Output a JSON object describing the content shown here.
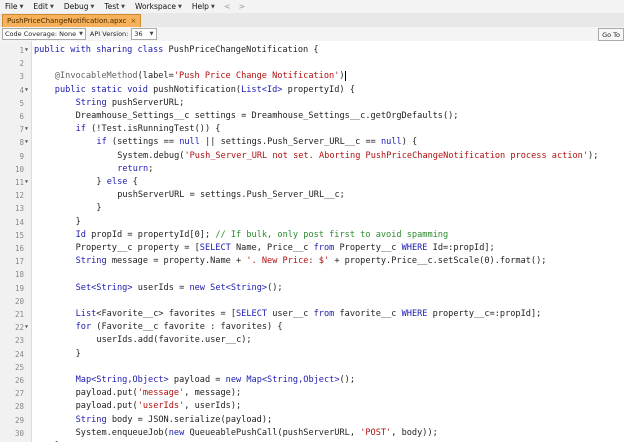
{
  "menu": {
    "items": [
      {
        "label": "File"
      },
      {
        "label": "Edit"
      },
      {
        "label": "Debug"
      },
      {
        "label": "Test"
      },
      {
        "label": "Workspace"
      },
      {
        "label": "Help"
      }
    ],
    "back": "<",
    "forward": ">"
  },
  "tab": {
    "title": "PushPriceChangeNotification.apxc",
    "close": "×"
  },
  "toolbar": {
    "coverage_label": "Code Coverage: None",
    "api_label": "API Version:",
    "api_value": "36",
    "goto_label": "Go To"
  },
  "editor": {
    "lines": [
      {
        "n": "1",
        "fold": true,
        "indent": 0,
        "tokens": [
          {
            "t": "kw",
            "v": "public with sharing class "
          },
          {
            "t": "pl",
            "v": "PushPriceChangeNotification {"
          }
        ]
      },
      {
        "n": "2",
        "fold": false,
        "indent": 0,
        "tokens": []
      },
      {
        "n": "3",
        "fold": false,
        "indent": 4,
        "tokens": [
          {
            "t": "an",
            "v": "@InvocableMethod"
          },
          {
            "t": "pl",
            "v": "(label="
          },
          {
            "t": "st",
            "v": "'Push Price Change Notification'"
          },
          {
            "t": "pl",
            "v": ")"
          },
          {
            "t": "cur",
            "v": ""
          }
        ]
      },
      {
        "n": "4",
        "fold": true,
        "indent": 4,
        "tokens": [
          {
            "t": "kw",
            "v": "public static void "
          },
          {
            "t": "pl",
            "v": "pushNotification("
          },
          {
            "t": "ty",
            "v": "List<Id>"
          },
          {
            "t": "pl",
            "v": " propertyId) {"
          }
        ]
      },
      {
        "n": "5",
        "fold": false,
        "indent": 8,
        "tokens": [
          {
            "t": "ty",
            "v": "String"
          },
          {
            "t": "pl",
            "v": " pushServerURL;"
          }
        ]
      },
      {
        "n": "6",
        "fold": false,
        "indent": 8,
        "tokens": [
          {
            "t": "pl",
            "v": "Dreamhouse_Settings__c settings = Dreamhouse_Settings__c.getOrgDefaults();"
          }
        ]
      },
      {
        "n": "7",
        "fold": true,
        "indent": 8,
        "tokens": [
          {
            "t": "kw",
            "v": "if"
          },
          {
            "t": "pl",
            "v": " (!Test.isRunningTest()) {"
          }
        ]
      },
      {
        "n": "8",
        "fold": true,
        "indent": 12,
        "tokens": [
          {
            "t": "kw",
            "v": "if"
          },
          {
            "t": "pl",
            "v": " (settings == "
          },
          {
            "t": "kw",
            "v": "null"
          },
          {
            "t": "pl",
            "v": " || settings.Push_Server_URL__c == "
          },
          {
            "t": "kw",
            "v": "null"
          },
          {
            "t": "pl",
            "v": ") {"
          }
        ]
      },
      {
        "n": "9",
        "fold": false,
        "indent": 16,
        "tokens": [
          {
            "t": "pl",
            "v": "System.debug("
          },
          {
            "t": "st",
            "v": "'Push_Server_URL not set. Aborting PushPriceChangeNotification process action'"
          },
          {
            "t": "pl",
            "v": ");"
          }
        ]
      },
      {
        "n": "10",
        "fold": false,
        "indent": 16,
        "tokens": [
          {
            "t": "kw",
            "v": "return"
          },
          {
            "t": "pl",
            "v": ";"
          }
        ]
      },
      {
        "n": "11",
        "fold": true,
        "indent": 12,
        "tokens": [
          {
            "t": "pl",
            "v": "} "
          },
          {
            "t": "kw",
            "v": "else"
          },
          {
            "t": "pl",
            "v": " {"
          }
        ]
      },
      {
        "n": "12",
        "fold": false,
        "indent": 16,
        "tokens": [
          {
            "t": "pl",
            "v": "pushServerURL = settings.Push_Server_URL__c;"
          }
        ]
      },
      {
        "n": "13",
        "fold": false,
        "indent": 12,
        "tokens": [
          {
            "t": "pl",
            "v": "}"
          }
        ]
      },
      {
        "n": "14",
        "fold": false,
        "indent": 8,
        "tokens": [
          {
            "t": "pl",
            "v": "}"
          }
        ]
      },
      {
        "n": "15",
        "fold": false,
        "indent": 8,
        "tokens": [
          {
            "t": "ty",
            "v": "Id"
          },
          {
            "t": "pl",
            "v": " propId = propertyId[0]; "
          },
          {
            "t": "cm",
            "v": "// If bulk, only post first to avoid spamming"
          }
        ]
      },
      {
        "n": "16",
        "fold": false,
        "indent": 8,
        "tokens": [
          {
            "t": "pl",
            "v": "Property__c property = ["
          },
          {
            "t": "kw",
            "v": "SELECT"
          },
          {
            "t": "pl",
            "v": " Name, Price__c "
          },
          {
            "t": "kw",
            "v": "from"
          },
          {
            "t": "pl",
            "v": " Property__c "
          },
          {
            "t": "kw",
            "v": "WHERE"
          },
          {
            "t": "pl",
            "v": " Id=:propId];"
          }
        ]
      },
      {
        "n": "17",
        "fold": false,
        "indent": 8,
        "tokens": [
          {
            "t": "ty",
            "v": "String"
          },
          {
            "t": "pl",
            "v": " message = property.Name + "
          },
          {
            "t": "st",
            "v": "'. New Price: $'"
          },
          {
            "t": "pl",
            "v": " + property.Price__c.setScale(0).format();"
          }
        ]
      },
      {
        "n": "18",
        "fold": false,
        "indent": 0,
        "tokens": []
      },
      {
        "n": "19",
        "fold": false,
        "indent": 8,
        "tokens": [
          {
            "t": "ty",
            "v": "Set<String>"
          },
          {
            "t": "pl",
            "v": " userIds = "
          },
          {
            "t": "kw",
            "v": "new "
          },
          {
            "t": "ty",
            "v": "Set<String>"
          },
          {
            "t": "pl",
            "v": "();"
          }
        ]
      },
      {
        "n": "20",
        "fold": false,
        "indent": 0,
        "tokens": []
      },
      {
        "n": "21",
        "fold": false,
        "indent": 8,
        "tokens": [
          {
            "t": "ty",
            "v": "List"
          },
          {
            "t": "pl",
            "v": "<Favorite__c> favorites = ["
          },
          {
            "t": "kw",
            "v": "SELECT"
          },
          {
            "t": "pl",
            "v": " user__c "
          },
          {
            "t": "kw",
            "v": "from"
          },
          {
            "t": "pl",
            "v": " favorite__c "
          },
          {
            "t": "kw",
            "v": "WHERE"
          },
          {
            "t": "pl",
            "v": " property__c=:propId];"
          }
        ]
      },
      {
        "n": "22",
        "fold": true,
        "indent": 8,
        "tokens": [
          {
            "t": "kw",
            "v": "for"
          },
          {
            "t": "pl",
            "v": " (Favorite__c favorite : favorites) {"
          }
        ]
      },
      {
        "n": "23",
        "fold": false,
        "indent": 12,
        "tokens": [
          {
            "t": "pl",
            "v": "userIds.add(favorite.user__c);"
          }
        ]
      },
      {
        "n": "24",
        "fold": false,
        "indent": 8,
        "tokens": [
          {
            "t": "pl",
            "v": "}"
          }
        ]
      },
      {
        "n": "25",
        "fold": false,
        "indent": 0,
        "tokens": []
      },
      {
        "n": "26",
        "fold": false,
        "indent": 8,
        "tokens": [
          {
            "t": "ty",
            "v": "Map<String,Object>"
          },
          {
            "t": "pl",
            "v": " payload = "
          },
          {
            "t": "kw",
            "v": "new "
          },
          {
            "t": "ty",
            "v": "Map<String,Object>"
          },
          {
            "t": "pl",
            "v": "();"
          }
        ]
      },
      {
        "n": "27",
        "fold": false,
        "indent": 8,
        "tokens": [
          {
            "t": "pl",
            "v": "payload.put("
          },
          {
            "t": "st",
            "v": "'message'"
          },
          {
            "t": "pl",
            "v": ", message);"
          }
        ]
      },
      {
        "n": "28",
        "fold": false,
        "indent": 8,
        "tokens": [
          {
            "t": "pl",
            "v": "payload.put("
          },
          {
            "t": "st",
            "v": "'userIds'"
          },
          {
            "t": "pl",
            "v": ", userIds);"
          }
        ]
      },
      {
        "n": "29",
        "fold": false,
        "indent": 8,
        "tokens": [
          {
            "t": "ty",
            "v": "String"
          },
          {
            "t": "pl",
            "v": " body = JSON.serialize(payload);"
          }
        ]
      },
      {
        "n": "30",
        "fold": false,
        "indent": 8,
        "tokens": [
          {
            "t": "pl",
            "v": "System.enqueueJob("
          },
          {
            "t": "kw",
            "v": "new"
          },
          {
            "t": "pl",
            "v": " QueueablePushCall(pushServerURL, "
          },
          {
            "t": "st",
            "v": "'POST'"
          },
          {
            "t": "pl",
            "v": ", body));"
          }
        ]
      },
      {
        "n": "31",
        "fold": false,
        "indent": 4,
        "tokens": [
          {
            "t": "pl",
            "v": "}"
          }
        ]
      }
    ]
  },
  "colors": {
    "tab_active": "#f7b15a",
    "keyword": "#1b1bb0",
    "string": "#b01010",
    "comment": "#2d8a2d"
  }
}
